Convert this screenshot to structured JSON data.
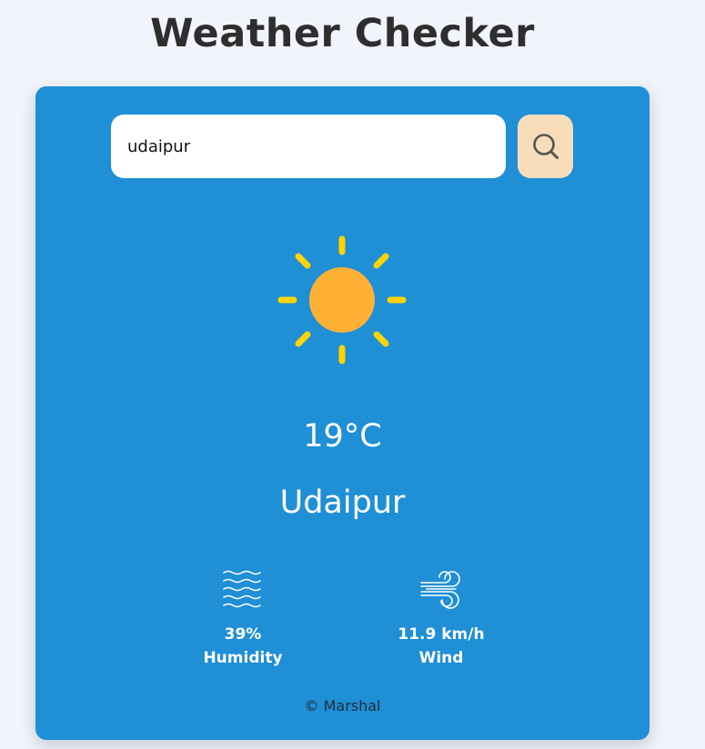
{
  "app": {
    "title": "Weather Checker"
  },
  "search": {
    "value": "udaipur",
    "button_icon": "search-icon"
  },
  "weather": {
    "icon": "sun-icon",
    "temperature": "19°C",
    "city": "Udaipur"
  },
  "details": {
    "humidity": {
      "icon": "humidity-waves-icon",
      "value": "39%",
      "label": "Humidity"
    },
    "wind": {
      "icon": "wind-icon",
      "value": "11.9 km/h",
      "label": "Wind"
    }
  },
  "footer": {
    "text": "© Marshal"
  },
  "colors": {
    "page_background": "#f1f4fb",
    "card_background": "#1f8fd6",
    "search_button_background": "#f7ddb9",
    "sun_core": "#ffb136",
    "sun_rays": "#ffd400",
    "title_text": "#2e2e2e"
  }
}
